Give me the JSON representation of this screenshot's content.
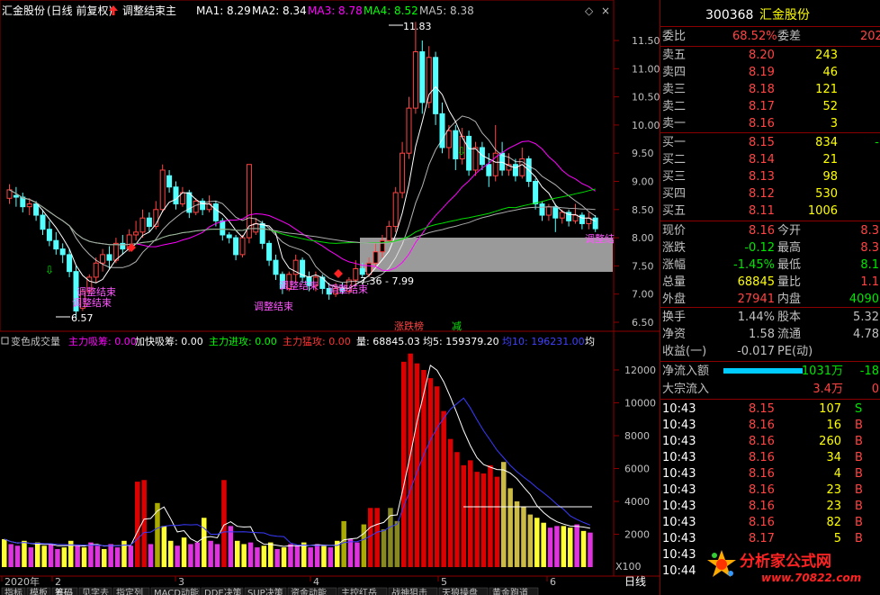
{
  "header": {
    "stock": "汇金股份",
    "mode": "(日线 前复权)",
    "indicator": "调整结束主",
    "ma": [
      {
        "label": "MA1: 8.29",
        "color": "#ffffff"
      },
      {
        "label": "MA2: 8.34",
        "color": "#ffffff"
      },
      {
        "label": "MA3: 8.78",
        "color": "#ff00ff"
      },
      {
        "label": "MA4: 8.52",
        "color": "#00ff00"
      },
      {
        "label": "MA5: 8.38",
        "color": "#c0c0c0"
      }
    ]
  },
  "price_axis": [
    "11.50",
    "11.00",
    "10.50",
    "10.00",
    "9.50",
    "9.00",
    "8.50",
    "8.00",
    "7.50",
    "7.00",
    "6.50"
  ],
  "volume_axis": [
    "12000",
    "10000",
    "8000",
    "6000",
    "4000",
    "2000"
  ],
  "volume_unit": "X100",
  "annotations": {
    "high": "11.83",
    "low": "6.57",
    "box_range": "7.36 - 7.99",
    "sig1": "调整结束",
    "sig2": "调整结束",
    "sig3": "调整结束",
    "sig4": "调整结束",
    "sig5": "调整结束",
    "sig_right": "调整结",
    "limit_tag": "涨跌榜",
    "reduce_tag": "减"
  },
  "sub_header": [
    {
      "text": "变色成交量",
      "color": "#c0c0c0"
    },
    {
      "text": "主力吸筹: 0.00",
      "color": "#ff00ff"
    },
    {
      "text": "加快吸筹: 0.00",
      "color": "#ffffff"
    },
    {
      "text": "主力进攻: 0.00",
      "color": "#00ff00"
    },
    {
      "text": "主力猛攻: 0.00",
      "color": "#ff3333"
    },
    {
      "text": "量: 68845.03",
      "color": "#ffffff"
    },
    {
      "text": "均5: 159379.20",
      "color": "#ffffff"
    },
    {
      "text": "均10: 196231.00",
      "color": "#4040ff"
    },
    {
      "text": "均",
      "color": "#ffffff"
    }
  ],
  "time_axis": [
    {
      "label": "2020年",
      "pos": 0
    },
    {
      "label": "2",
      "pos": 1
    },
    {
      "label": "3",
      "pos": 2
    },
    {
      "label": "4",
      "pos": 3
    },
    {
      "label": "5",
      "pos": 4
    },
    {
      "label": "6",
      "pos": 5
    }
  ],
  "period_label": "日线",
  "tabs": [
    "指标",
    "模板",
    "筹码",
    "见字去",
    "指定列",
    "MACD动能",
    "DDE决策",
    "SUP决策",
    "资金动能",
    "主控红岳",
    "战神狙击",
    "天狼操盘",
    "黄金跑道"
  ],
  "quote": {
    "code": "300368",
    "name": "汇金股份",
    "weibi_label": "委比",
    "weibi": "68.52%",
    "weicha_label": "委差",
    "weicha": "202",
    "asks": [
      {
        "label": "卖五",
        "price": "8.20",
        "vol": "243"
      },
      {
        "label": "卖四",
        "price": "8.19",
        "vol": "46"
      },
      {
        "label": "卖三",
        "price": "8.18",
        "vol": "121"
      },
      {
        "label": "卖二",
        "price": "8.17",
        "vol": "52"
      },
      {
        "label": "卖一",
        "price": "8.16",
        "vol": "3"
      }
    ],
    "bids": [
      {
        "label": "买一",
        "price": "8.15",
        "vol": "834",
        "chg": "-"
      },
      {
        "label": "买二",
        "price": "8.14",
        "vol": "21",
        "chg": ""
      },
      {
        "label": "买三",
        "price": "8.13",
        "vol": "98",
        "chg": ""
      },
      {
        "label": "买四",
        "price": "8.12",
        "vol": "530",
        "chg": ""
      },
      {
        "label": "买五",
        "price": "8.11",
        "vol": "1006",
        "chg": ""
      }
    ],
    "stats": [
      {
        "l1": "现价",
        "v1": "8.16",
        "c1": "#ff4444",
        "l2": "今开",
        "v2": "8.3",
        "c2": "#ff4444"
      },
      {
        "l1": "涨跌",
        "v1": "-0.12",
        "c1": "#00e600",
        "l2": "最高",
        "v2": "8.3",
        "c2": "#ff4444"
      },
      {
        "l1": "涨幅",
        "v1": "-1.45%",
        "c1": "#00e600",
        "l2": "最低",
        "v2": "8.1",
        "c2": "#00e600"
      },
      {
        "l1": "总量",
        "v1": "68845",
        "c1": "#ffff00",
        "l2": "量比",
        "v2": "1.1",
        "c2": "#ff4444"
      },
      {
        "l1": "外盘",
        "v1": "27941",
        "c1": "#ff4444",
        "l2": "内盘",
        "v2": "4090",
        "c2": "#00e600"
      }
    ],
    "stats2": [
      {
        "l1": "换手",
        "v1": "1.44%",
        "c1": "#c0c0c0",
        "l2": "股本",
        "v2": "5.32",
        "c2": "#c0c0c0"
      },
      {
        "l1": "净资",
        "v1": "1.58",
        "c1": "#c0c0c0",
        "l2": "流通",
        "v2": "4.78",
        "c2": "#c0c0c0"
      },
      {
        "l1": "收益(一)",
        "v1": "-0.017",
        "c1": "#c0c0c0",
        "l2": "PE(动)",
        "v2": "",
        "c2": "#c0c0c0"
      }
    ],
    "flow": [
      {
        "label": "净流入额",
        "value": "-1031万",
        "extra": "-18"
      },
      {
        "label": "大宗流入",
        "value": "3.4万",
        "extra": "0"
      }
    ],
    "ticks": [
      {
        "time": "10:43",
        "price": "8.15",
        "vol": "107",
        "side": "S"
      },
      {
        "time": "10:43",
        "price": "8.16",
        "vol": "16",
        "side": "B"
      },
      {
        "time": "10:43",
        "price": "8.16",
        "vol": "260",
        "side": "B"
      },
      {
        "time": "10:43",
        "price": "8.16",
        "vol": "34",
        "side": "B"
      },
      {
        "time": "10:43",
        "price": "8.16",
        "vol": "4",
        "side": "B"
      },
      {
        "time": "10:43",
        "price": "8.16",
        "vol": "23",
        "side": "B"
      },
      {
        "time": "10:43",
        "price": "8.16",
        "vol": "23",
        "side": "B"
      },
      {
        "time": "10:43",
        "price": "8.16",
        "vol": "82",
        "side": "B"
      },
      {
        "time": "10:43",
        "price": "8.17",
        "vol": "5",
        "side": "B"
      },
      {
        "time": "10:43",
        "price": "",
        "vol": "",
        "side": ""
      },
      {
        "time": "10:44",
        "price": "",
        "vol": "",
        "side": ""
      }
    ]
  },
  "watermark": {
    "cn": "分析家公式网",
    "url": "www.70822.com"
  }
}
